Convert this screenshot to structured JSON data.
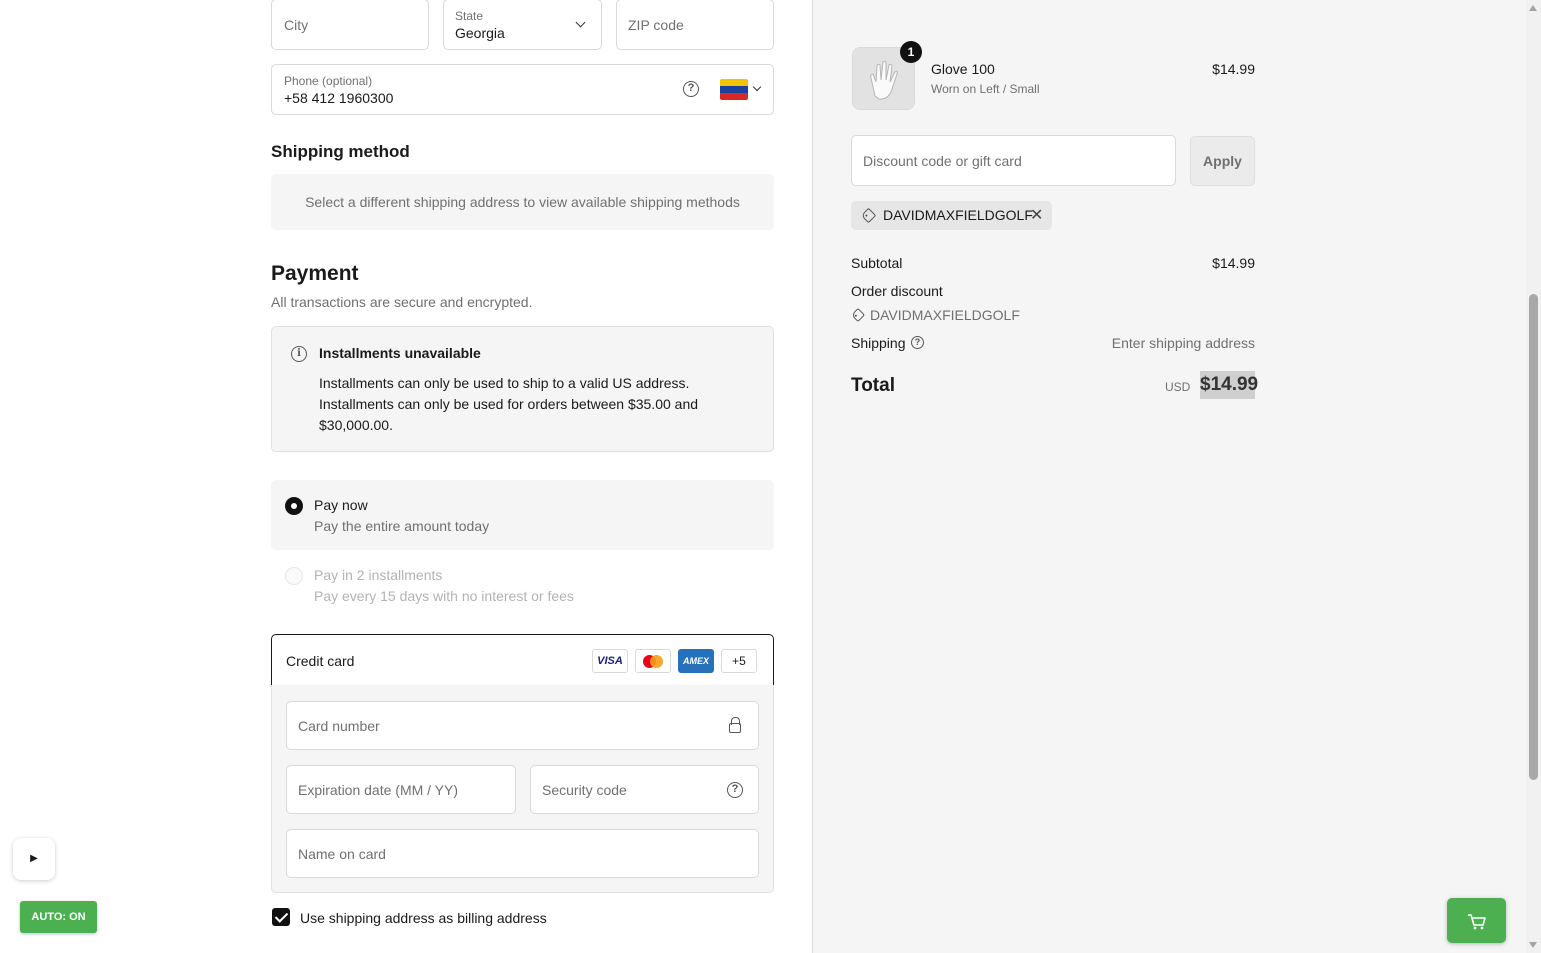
{
  "address": {
    "city_placeholder": "City",
    "state_label": "State",
    "state_value": "Georgia",
    "zip_placeholder": "ZIP code",
    "phone_label": "Phone (optional)",
    "phone_value": "+58 412 1960300",
    "help_glyph": "?",
    "country_flag_icon": "venezuela-flag-icon"
  },
  "shipping_method": {
    "title": "Shipping method",
    "message": "Select a different shipping address to view available shipping methods"
  },
  "payment": {
    "title": "Payment",
    "subtitle": "All transactions are secure and encrypted.",
    "notice": {
      "icon_glyph": "i",
      "title": "Installments unavailable",
      "line1": "Installments can only be used to ship to a valid US address.",
      "line2": "Installments can only be used for orders between $35.00 and $30,000.00."
    },
    "options": [
      {
        "title": "Pay now",
        "subtitle": "Pay the entire amount today",
        "selected": true
      },
      {
        "title": "Pay in 2 installments",
        "subtitle": "Pay every 15 days with no interest or fees",
        "selected": false,
        "disabled": true
      }
    ],
    "credit_card": {
      "label": "Credit card",
      "brands": {
        "visa": "VISA",
        "amex": "AMEX",
        "more": "+5"
      },
      "card_number_placeholder": "Card number",
      "expiration_placeholder": "Expiration date (MM / YY)",
      "security_placeholder": "Security code",
      "name_placeholder": "Name on card"
    },
    "billing_checkbox_label": "Use shipping address as billing address",
    "billing_checkbox_checked": true
  },
  "overlay": {
    "play_glyph": "▶",
    "auto_label": "AUTO: ON",
    "accent": "#4caf50"
  },
  "order_summary": {
    "item": {
      "quantity": "1",
      "name": "Glove 100",
      "variant": "Worn on Left / Small",
      "price": "$14.99"
    },
    "discount_placeholder": "Discount code or gift card",
    "apply_label": "Apply",
    "applied_code": "DAVIDMAXFIELDGOLF",
    "remove_glyph": "✕",
    "subtotal_label": "Subtotal",
    "subtotal_value": "$14.99",
    "order_discount_label": "Order discount",
    "order_discount_code": "DAVIDMAXFIELDGOLF",
    "shipping_label": "Shipping",
    "shipping_value": "Enter shipping address",
    "total_label": "Total",
    "total_currency": "USD",
    "total_value": "$14.99"
  }
}
